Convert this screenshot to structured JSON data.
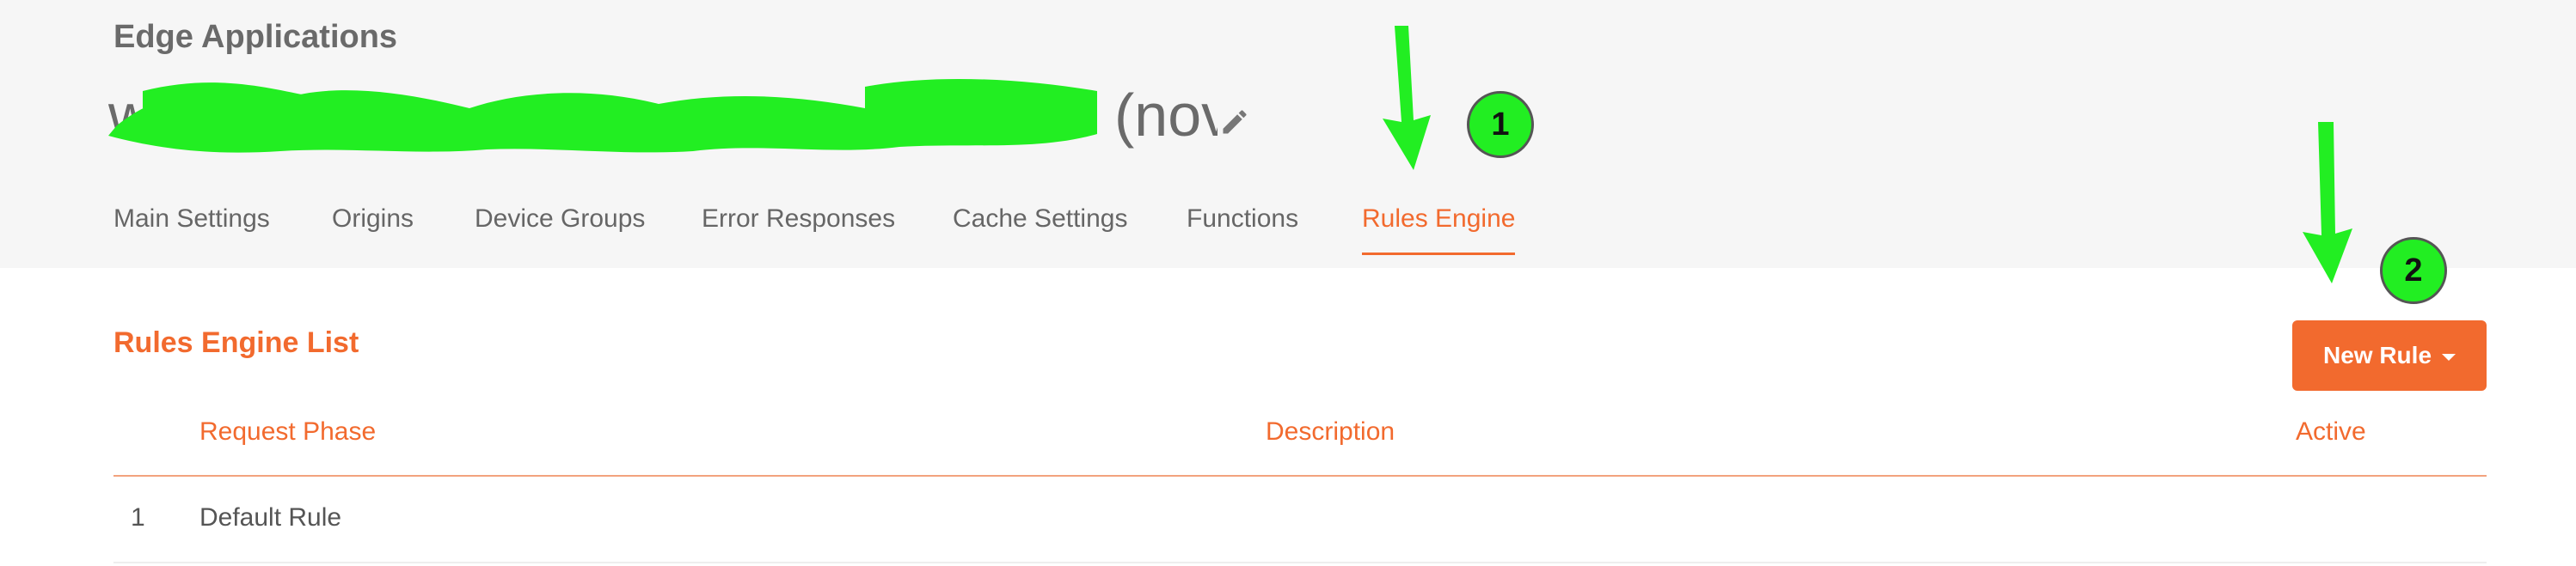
{
  "breadcrumb": "Edge Applications",
  "app_title": {
    "visible_suffix": "(nov",
    "edit_icon": "pencil-icon"
  },
  "tabs": [
    {
      "label": "Main Settings",
      "active": false
    },
    {
      "label": "Origins",
      "active": false
    },
    {
      "label": "Device Groups",
      "active": false
    },
    {
      "label": "Error Responses",
      "active": false
    },
    {
      "label": "Cache Settings",
      "active": false
    },
    {
      "label": "Functions",
      "active": false
    },
    {
      "label": "Rules Engine",
      "active": true
    }
  ],
  "section": {
    "title": "Rules Engine List",
    "new_rule_label": "New Rule"
  },
  "table": {
    "columns": [
      "Request Phase",
      "Description",
      "Active"
    ],
    "rows": [
      {
        "index": "1",
        "name": "Default Rule"
      }
    ]
  },
  "annotations": {
    "markers": [
      "1",
      "2"
    ],
    "arrow_color": "#22ee22"
  },
  "colors": {
    "accent": "#f26a2e",
    "header_bg": "#f6f6f6",
    "annotation_green": "#22ee22"
  }
}
